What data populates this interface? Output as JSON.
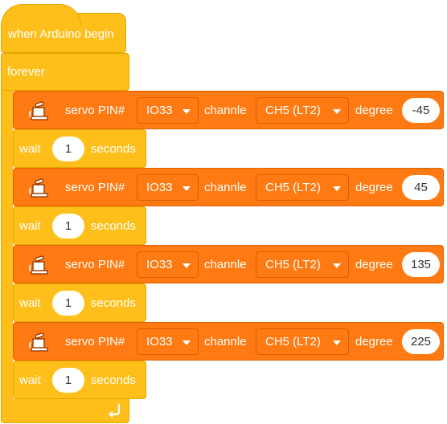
{
  "hat": {
    "label": "when Arduino begin"
  },
  "forever": {
    "label": "forever",
    "loop_icon": "loop-arrow-icon"
  },
  "servo_common": {
    "label": "servo PIN#",
    "channel_label": "channle",
    "degree_label": "degree",
    "icon": "servo-motor-icon"
  },
  "servos": [
    {
      "pin": "IO33",
      "channel": "CH5 (LT2)",
      "degree": "-45"
    },
    {
      "pin": "IO33",
      "channel": "CH5 (LT2)",
      "degree": "45"
    },
    {
      "pin": "IO33",
      "channel": "CH5 (LT2)",
      "degree": "135"
    },
    {
      "pin": "IO33",
      "channel": "CH5 (LT2)",
      "degree": "225"
    }
  ],
  "wait_common": {
    "label": "wait",
    "unit": "seconds"
  },
  "waits": [
    {
      "value": "1"
    },
    {
      "value": "1"
    },
    {
      "value": "1"
    },
    {
      "value": "1"
    }
  ],
  "colors": {
    "event": "#FFBF1A",
    "servo": "#FF7A12"
  }
}
